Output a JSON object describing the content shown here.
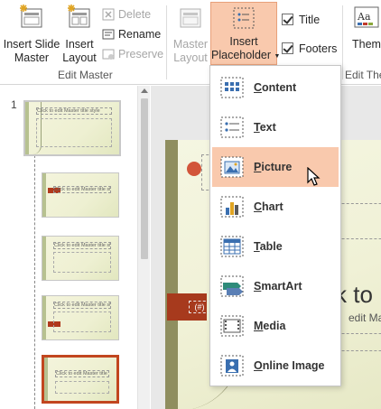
{
  "ribbon": {
    "insert_slide_master": [
      "Insert Slide",
      "Master"
    ],
    "insert_layout": [
      "Insert",
      "Layout"
    ],
    "delete": "Delete",
    "rename": "Rename",
    "preserve": "Preserve",
    "edit_master_group": "Edit Master",
    "master_layout": [
      "Master",
      "Layout"
    ],
    "insert_placeholder": [
      "Insert",
      "Placeholder"
    ],
    "title_check": "Title",
    "footers_check": "Footers",
    "themes": "Themes",
    "edit_theme_group": "Edit The"
  },
  "thumbnails": {
    "slide_number": "1",
    "master_title": "Click to edit Master title style",
    "layouts": [
      {
        "title": "Click to edit Master title style"
      },
      {
        "title": "Click to edit Master title style"
      },
      {
        "title": "Click to edit Master title style"
      },
      {
        "title": "Click to edit Master title style"
      }
    ]
  },
  "slide": {
    "title_fragment": "k to",
    "subtitle_fragment": "edit Ma",
    "number_placeholder": "(#)"
  },
  "menu": {
    "items": [
      {
        "label_u": "C",
        "label_rest": "ontent",
        "icon": "content-icon"
      },
      {
        "label_u": "T",
        "label_rest": "ext",
        "icon": "text-icon"
      },
      {
        "label_u": "P",
        "label_rest": "icture",
        "icon": "picture-icon"
      },
      {
        "label_u": "C",
        "label_rest": "hart",
        "icon": "chart-icon"
      },
      {
        "label_u": "T",
        "label_rest": "able",
        "icon": "table-icon"
      },
      {
        "label_u": "S",
        "label_rest": "martArt",
        "icon": "smartart-icon"
      },
      {
        "label_u": "M",
        "label_rest": "edia",
        "icon": "media-icon"
      },
      {
        "label_u": "O",
        "label_rest": "nline Image",
        "icon": "online-image-icon"
      }
    ],
    "hovered_index": 2
  },
  "colors": {
    "accent": "#f9c9ad",
    "selected_thumb": "#c2461f",
    "slide_red": "#a73a1d"
  }
}
